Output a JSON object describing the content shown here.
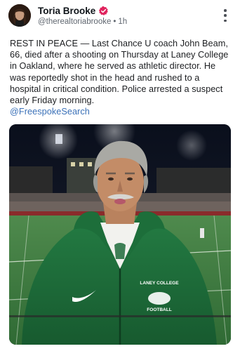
{
  "post": {
    "author": {
      "display_name": "Toria Brooke",
      "handle": "@therealtoriabrooke",
      "separator": "•",
      "time_ago": "1h",
      "verified": true
    },
    "text": "REST IN PEACE — Last Chance U coach John Beam, 66, died after a shooting on Thursday at Laney College in Oakland, where he served as athletic director. He was reportedly shot in the head and rushed to a hospital in critical condition. Police arrested a suspect early Friday morning.",
    "mention": "@FreespokeSearch",
    "image": {
      "jacket_text_line1": "LANEY COLLEGE",
      "jacket_text_line2": "FOOTBALL"
    }
  },
  "colors": {
    "verified_badge": "#e0245e",
    "link": "#3b71b8",
    "jacket_green": "#1f6b3a"
  },
  "icons": {
    "verified": "verified-badge-icon",
    "more": "more-vertical-icon"
  }
}
